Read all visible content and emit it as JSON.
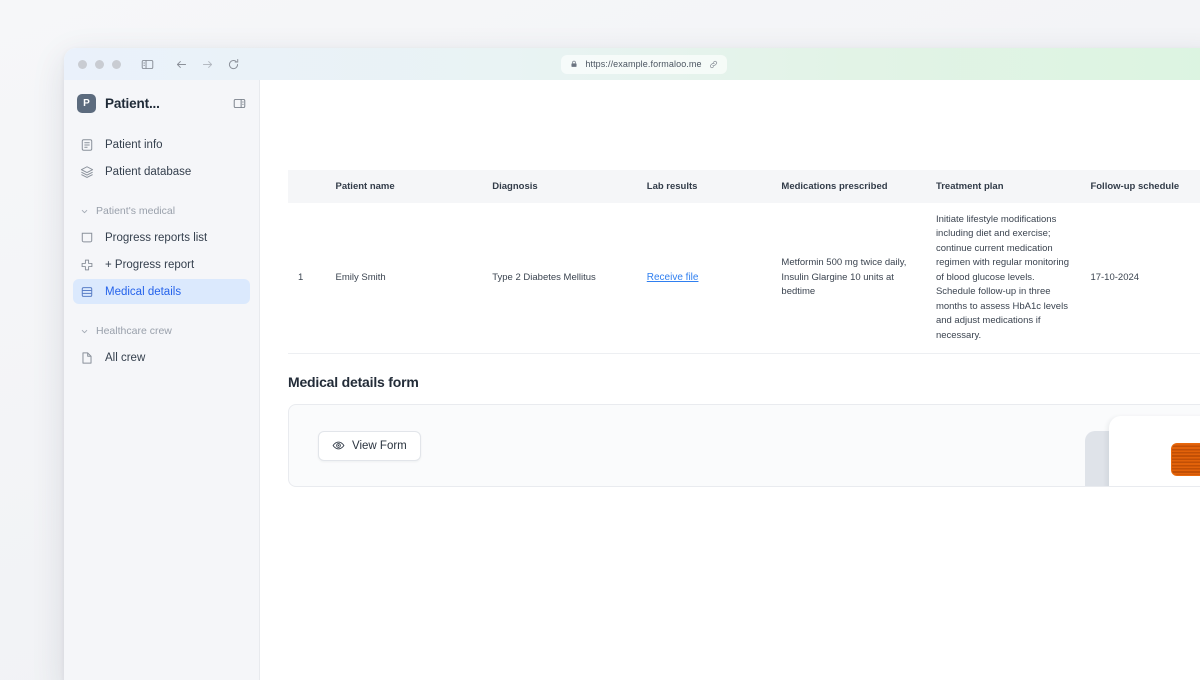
{
  "browser": {
    "url": "https://example.formaloo.me",
    "lock_icon": "lock-icon",
    "link_icon": "link-icon",
    "back_icon": "arrow-left-icon",
    "forward_icon": "arrow-right-icon",
    "reload_icon": "reload-icon",
    "sidebar_icon": "panel-toggle-icon"
  },
  "sidebar": {
    "brand": {
      "initial": "P",
      "name": "Patient..."
    },
    "panel_toggle_icon": "panel-toggle-icon",
    "top_items": [
      {
        "label": "Patient info",
        "icon": "document-icon"
      },
      {
        "label": "Patient database",
        "icon": "layers-icon"
      }
    ],
    "sections": [
      {
        "label": "Patient's medical",
        "chevron": "chevron-down-icon",
        "items": [
          {
            "label": "Progress reports list",
            "icon": "window-icon",
            "active": false
          },
          {
            "label": "+ Progress report",
            "icon": "plus-cross-icon",
            "active": false
          },
          {
            "label": "Medical details",
            "icon": "table-icon",
            "active": true
          }
        ]
      },
      {
        "label": "Healthcare crew",
        "chevron": "chevron-down-icon",
        "items": [
          {
            "label": "All crew",
            "icon": "file-icon",
            "active": false
          }
        ]
      }
    ]
  },
  "table": {
    "columns": [
      "",
      "Patient name",
      "Diagnosis",
      "Lab results",
      "Medications prescribed",
      "Treatment plan",
      "Follow-up schedule"
    ],
    "rows": [
      {
        "index": "1",
        "patient_name": "Emily Smith",
        "diagnosis": "Type 2 Diabetes Mellitus",
        "lab_results_link": "Receive file",
        "medications": "Metformin 500 mg twice daily, Insulin Glargine 10 units at bedtime",
        "treatment_plan": "Initiate lifestyle modifications including diet and exercise; continue current medication regimen with regular monitoring of blood glucose levels. Schedule follow-up in three months to assess HbA1c levels and adjust medications if necessary.",
        "followup": "17-10-2024"
      }
    ]
  },
  "form_section": {
    "title": "Medical details form",
    "view_button_label": "View Form",
    "view_button_icon": "eye-icon"
  },
  "colors": {
    "accent_blue": "#2563eb",
    "link_blue": "#2f7ff0",
    "active_bg": "#dbe9fd",
    "orange": "#e2620a",
    "sidebar_bg": "#f5f6f9"
  }
}
